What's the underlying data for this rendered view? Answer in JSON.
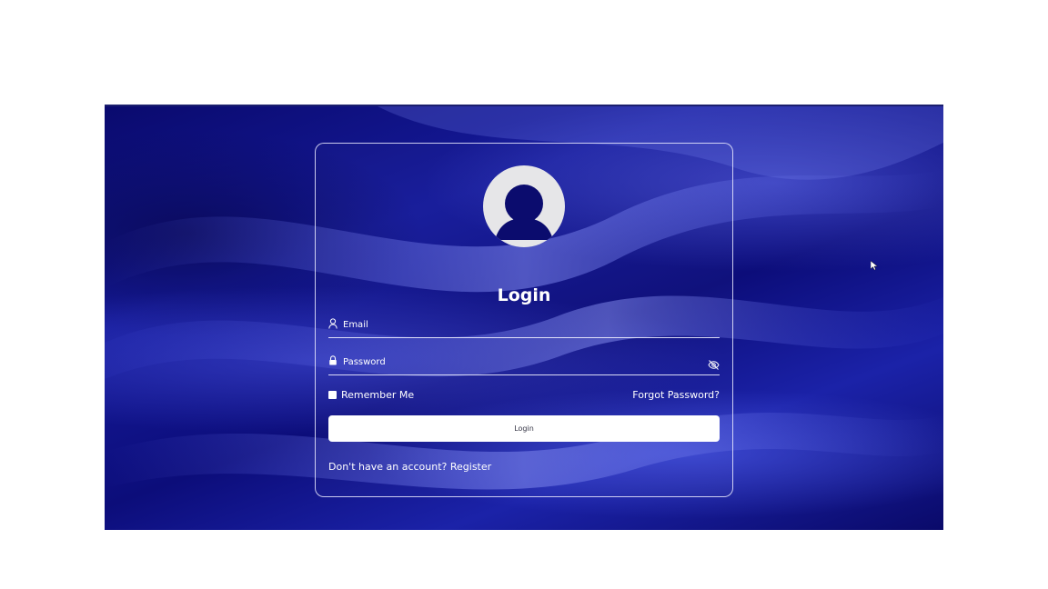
{
  "login_card": {
    "title": "Login",
    "email_label": "Email",
    "password_label": "Password",
    "remember_label": "Remember Me",
    "forgot_label": "Forgot Password?",
    "submit_label": "Login",
    "register_prompt": "Don't have an account? Register"
  },
  "icons": {
    "avatar": "user-avatar-icon",
    "email": "user-icon",
    "password": "lock-icon",
    "toggle": "eye-off-icon",
    "cursor": "mouse-pointer-icon"
  },
  "colors": {
    "background_dark": "#0a0a6e",
    "background_light": "#1b22a8",
    "card_border": "#ebebff",
    "button_bg": "#ffffff",
    "text": "#ffffff"
  }
}
